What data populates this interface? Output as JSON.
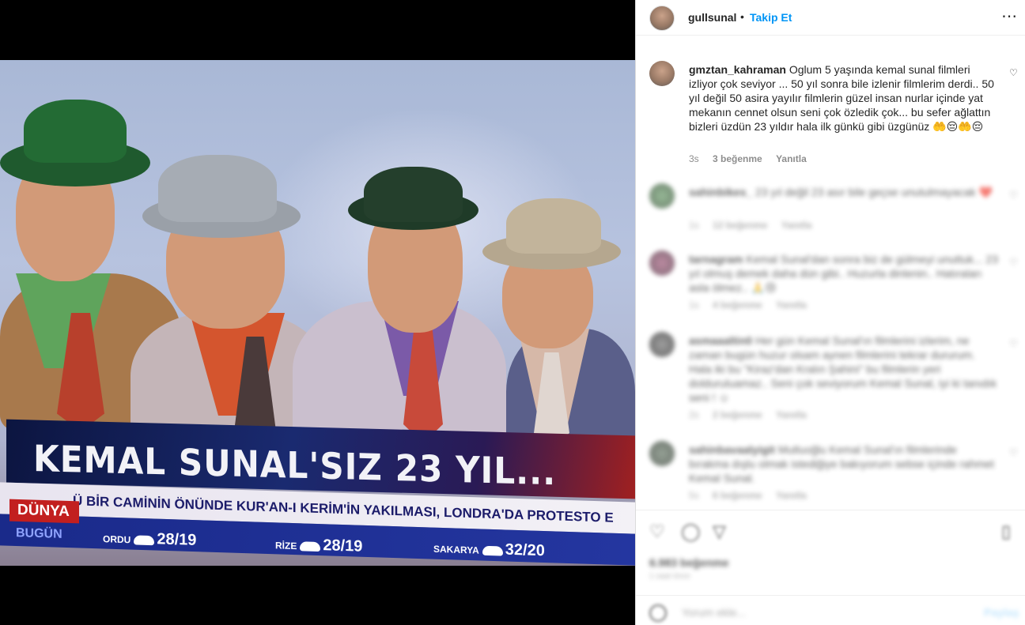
{
  "post": {
    "username": "gullsunal",
    "dot": "•",
    "follow_label": "Takip Et",
    "more_icon": "⋯"
  },
  "media": {
    "banner_title": "KEMAL SUNAL'SIZ 23 YIL...",
    "channel_tag": "DÜNYA",
    "bugun_tag": "BUGÜN",
    "ticker": "Ü BİR CAMİNİN ÖNÜNDE KUR'AN-I KERİM'İN YAKILMASI, LONDRA'DA PROTESTO E",
    "weather": [
      {
        "city": "ORDU",
        "temp": "28/19"
      },
      {
        "city": "RİZE",
        "temp": "28/19"
      },
      {
        "city": "SAKARYA",
        "temp": "32/20"
      }
    ]
  },
  "comments": [
    {
      "username": "gmztan_kahraman",
      "text": "Oglum 5 yaşında kemal sunal filmleri izliyor çok seviyor ... 50 yıl sonra bile izlenir filmlerim derdi.. 50 yıl değil 50 asira yayılır filmlerin güzel insan nurlar içinde yat mekanın cennet olsun seni çok özledik çok... bu sefer ağlattın bizleri üzdün 23 yıldır hala ilk günkü gibi üzgünüz 🤲😔🤲😔",
      "time": "3s",
      "likes": "3 beğenme",
      "reply": "Yanıtla"
    },
    {
      "username": "sahinbikes_",
      "text": "23 yıl değil 23 asır bile geçse unutulmayacak ❤️",
      "time": "1s",
      "likes": "12 beğenme",
      "reply": "Yanıtla"
    },
    {
      "username": "tarnagram",
      "text": "Kemal Sunal'dan sonra biz de gülmeyi unuttuk... 23 yıl olmuş demek daha dün gibi.. Huzurla dinlenin.. Hatıraları asla ölmez.. 🙏😢",
      "time": "1s",
      "likes": "4 beğenme",
      "reply": "Yanıtla"
    },
    {
      "username": "asmaaaltin0",
      "text": "Her gün Kemal Sunal'ın filmlerini izlerim, ne zaman bugün huzur olsam aynen filmlerini tekrar dururum. Hala iki bu \"Kiraz'dan Kralın Şahini\" bu filmlerin yeri dolduruluamaz.. Seni çok seviyorum Kemal Sunal, iyi ki tanıdık seni ! ☺",
      "time": "2s",
      "likes": "2 beğenme",
      "reply": "Yanıtla"
    },
    {
      "username": "sahinbavaalyigit",
      "text": "Mutluoğlu Kemal Sunal'ın filmlerinde bırakma dışlu olmak istediğiye bakıyorum sebse içinde rahmet Kemal Sunal.",
      "time": "5s",
      "likes": "6 beğenme",
      "reply": "Yanıtla"
    }
  ],
  "actions": {
    "like_icon": "♡",
    "comment_icon": "◯",
    "share_icon": "▽",
    "save_icon": "▯",
    "likes_count": "6.983 beğenme",
    "date": "1 saat önce",
    "add_comment_placeholder": "Yorum ekle...",
    "share_label": "Paylaş"
  },
  "colors": {
    "link_blue": "#0095f6",
    "text": "#262626",
    "muted": "#8e8e8e"
  }
}
